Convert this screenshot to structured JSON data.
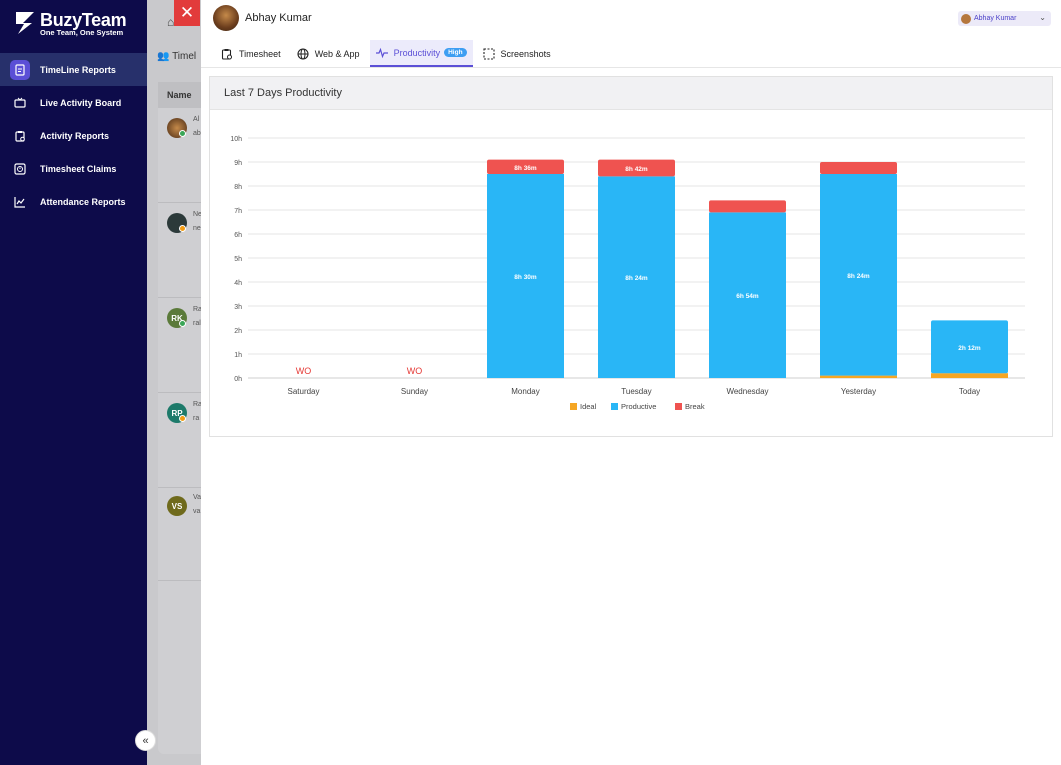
{
  "brand": {
    "name": "BuzyTeam",
    "tagline": "One Team, One System"
  },
  "sidebar": {
    "items": [
      {
        "label": "TimeLine Reports",
        "icon": "report-doc-icon",
        "active": true
      },
      {
        "label": "Live Activity Board",
        "icon": "tv-icon",
        "active": false
      },
      {
        "label": "Activity Reports",
        "icon": "clipboard-icon",
        "active": false
      },
      {
        "label": "Timesheet Claims",
        "icon": "clock-doc-icon",
        "active": false
      },
      {
        "label": "Attendance Reports",
        "icon": "trend-chart-icon",
        "active": false
      }
    ],
    "collapse_label": "«"
  },
  "background": {
    "tab_label": "Timel",
    "column_header": "Name",
    "rows": [
      {
        "initials": "",
        "name_fragment": "Al",
        "sub_fragment": "ab",
        "status_color": "#3aa657"
      },
      {
        "initials": "",
        "name_fragment": "Ne",
        "sub_fragment": "ne",
        "status_color": "#f39c12"
      },
      {
        "initials": "RK",
        "name_fragment": "Ra",
        "sub_fragment": "ral",
        "status_color": "#3aa657"
      },
      {
        "initials": "RP",
        "name_fragment": "Ra",
        "sub_fragment": "ra",
        "status_color": "#f39c12"
      },
      {
        "initials": "VS",
        "name_fragment": "Va",
        "sub_fragment": "va",
        "status_color": ""
      }
    ]
  },
  "drawer": {
    "close_label": "✕",
    "user_name": "Abhay Kumar",
    "user_select_value": "Abhay Kumar",
    "tabs": [
      {
        "label": "Timesheet",
        "icon": "clipboard-clock-icon",
        "active": false
      },
      {
        "label": "Web & App",
        "icon": "globe-icon",
        "active": false
      },
      {
        "label": "Productivity",
        "icon": "pulse-icon",
        "active": true,
        "badge": "High"
      },
      {
        "label": "Screenshots",
        "icon": "screenshot-icon",
        "active": false
      }
    ],
    "card_title": "Last 7 Days Productivity"
  },
  "colors": {
    "ideal": "#f5a623",
    "productive": "#29b6f6",
    "break": "#ef5350",
    "accent": "#5b4fd6",
    "sidebar": "#0d0b4a"
  },
  "chart_data": {
    "type": "bar",
    "stacked": true,
    "categories": [
      "Saturday",
      "Sunday",
      "Monday",
      "Tuesday",
      "Wednesday",
      "Yesterday",
      "Today"
    ],
    "ylim": [
      0,
      10
    ],
    "yticks": [
      "0h",
      "1h",
      "2h",
      "3h",
      "4h",
      "5h",
      "6h",
      "7h",
      "8h",
      "9h",
      "10h"
    ],
    "grid": true,
    "legend_position": "bottom",
    "series": [
      {
        "name": "Ideal",
        "values": [
          0,
          0,
          0,
          0,
          0,
          0.1,
          0.2
        ]
      },
      {
        "name": "Productive",
        "values": [
          0,
          0,
          8.5,
          8.4,
          6.9,
          8.4,
          2.2
        ],
        "labels": [
          "",
          "",
          "8h 30m",
          "8h 24m",
          "6h 54m",
          "8h 24m",
          "2h 12m"
        ]
      },
      {
        "name": "Break",
        "values": [
          0,
          0,
          0.6,
          0.7,
          0.5,
          0.5,
          0
        ],
        "labels": [
          "",
          "",
          "8h 36m",
          "8h 42m",
          "",
          "",
          ""
        ]
      }
    ],
    "annotations": [
      {
        "category": "Saturday",
        "text": "WO"
      },
      {
        "category": "Sunday",
        "text": "WO"
      }
    ]
  }
}
